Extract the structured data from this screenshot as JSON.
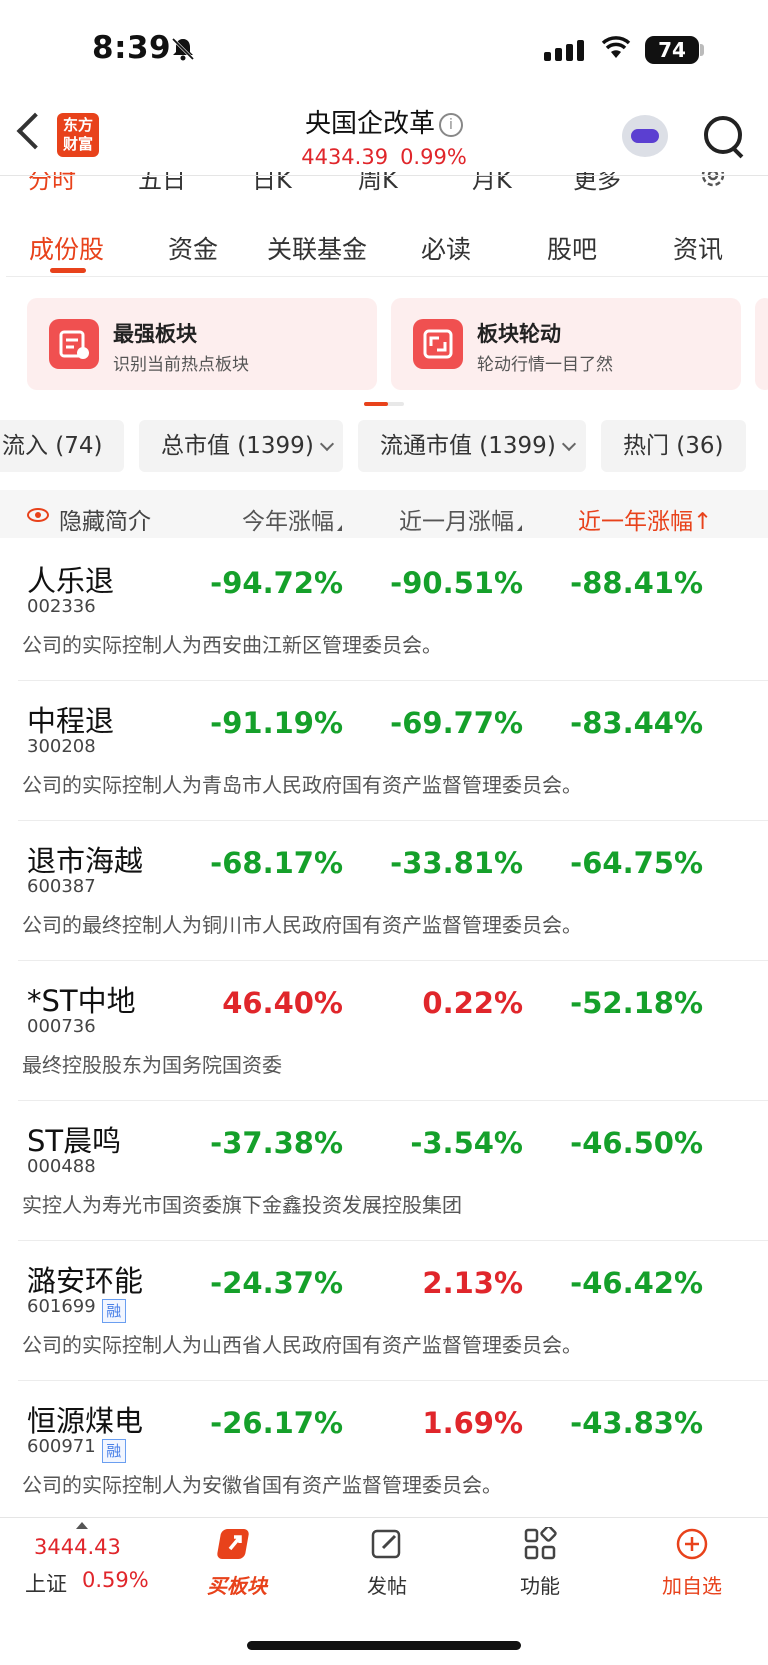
{
  "status": {
    "time": "8:39",
    "battery": "74"
  },
  "header": {
    "logo_line1": "东方",
    "logo_line2": "财富",
    "title": "央国企改革",
    "price": "4434.39",
    "change_pct": "0.99%"
  },
  "periods": [
    "分时",
    "五日",
    "日K",
    "周K",
    "月K",
    "更多"
  ],
  "tabs": [
    "成份股",
    "资金",
    "关联基金",
    "必读",
    "股吧",
    "资讯"
  ],
  "cards": [
    {
      "title": "最强板块",
      "sub": "识别当前热点板块"
    },
    {
      "title": "板块轮动",
      "sub": "轮动行情一目了然"
    }
  ],
  "filters": [
    "流入 (74)",
    "总市值 (1399)",
    "流通市值 (1399)",
    "热门 (36)"
  ],
  "table_header": {
    "hide": "隐藏简介",
    "col1": "今年涨幅",
    "col2": "近一月涨幅",
    "col3": "近一年涨幅",
    "sort_arrow": "↑"
  },
  "rows": [
    {
      "name": "人乐退",
      "code": "002336",
      "margin": "",
      "ytd": "-94.72%",
      "m1": "-90.51%",
      "y1": "-88.41%",
      "desc": "公司的实际控制人为西安曲江新区管理委员会。"
    },
    {
      "name": "中程退",
      "code": "300208",
      "margin": "",
      "ytd": "-91.19%",
      "m1": "-69.77%",
      "y1": "-83.44%",
      "desc": "公司的实际控制人为青岛市人民政府国有资产监督管理委员会。"
    },
    {
      "name": "退市海越",
      "code": "600387",
      "margin": "",
      "ytd": "-68.17%",
      "m1": "-33.81%",
      "y1": "-64.75%",
      "desc": "公司的最终控制人为铜川市人民政府国有资产监督管理委员会。"
    },
    {
      "name": "*ST中地",
      "code": "000736",
      "margin": "",
      "ytd": "46.40%",
      "m1": "0.22%",
      "y1": "-52.18%",
      "desc": "最终控股股东为国务院国资委"
    },
    {
      "name": "ST晨鸣",
      "code": "000488",
      "margin": "",
      "ytd": "-37.38%",
      "m1": "-3.54%",
      "y1": "-46.50%",
      "desc": "实控人为寿光市国资委旗下金鑫投资发展控股集团"
    },
    {
      "name": "潞安环能",
      "code": "601699",
      "margin": "融",
      "ytd": "-24.37%",
      "m1": "2.13%",
      "y1": "-46.42%",
      "desc": "公司的实际控制人为山西省人民政府国有资产监督管理委员会。"
    },
    {
      "name": "恒源煤电",
      "code": "600971",
      "margin": "融",
      "ytd": "-26.17%",
      "m1": "1.69%",
      "y1": "-43.83%",
      "desc": "公司的实际控制人为安徽省国有资产监督管理委员会。"
    }
  ],
  "bottom": {
    "index_value": "3444.43",
    "index_name": "上证",
    "index_pct": "0.59%",
    "buy": "买板块",
    "post": "发帖",
    "func": "功能",
    "add": "加自选"
  },
  "colors": {
    "up": "#e0262b",
    "down": "#15a02a",
    "accent": "#e8421b"
  }
}
